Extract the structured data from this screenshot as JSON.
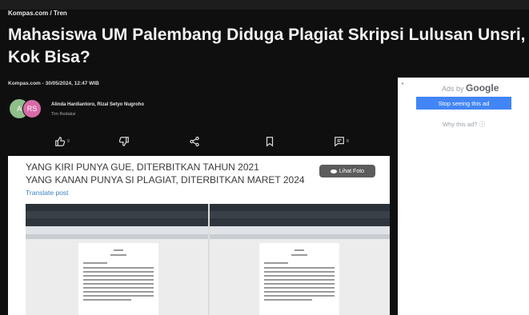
{
  "breadcrumb": "Kompas.com / Tren",
  "headline": {
    "line1": "Mahasiswa UM Palembang Diduga Plagiat Skripsi Lulusan Unsri,",
    "line2": "Kok Bisa?"
  },
  "meta": "Kompas.com - 30/05/2024, 12:47 WIB",
  "avatars": [
    "A",
    "RS"
  ],
  "authors": "Alinda Hardiantoro, Rizal Setyo Nugroho",
  "role": "Tim Redaksi",
  "actions": {
    "like_count": "9",
    "comment_count": "8"
  },
  "post": {
    "line1": "YANG KIRI PUNYA GUE, DITERBITKAN TAHUN 2021",
    "line2": "YANG KANAN PUNYA SI PLAGIAT, DITERBITKAN MARET 2024",
    "translate": "Translate post",
    "view_photo": "Lihat Foto"
  },
  "ad": {
    "ads_by": "Ads by",
    "brand": "Google",
    "stop": "Stop seeing this ad",
    "why": "Why this ad? ⓘ"
  }
}
